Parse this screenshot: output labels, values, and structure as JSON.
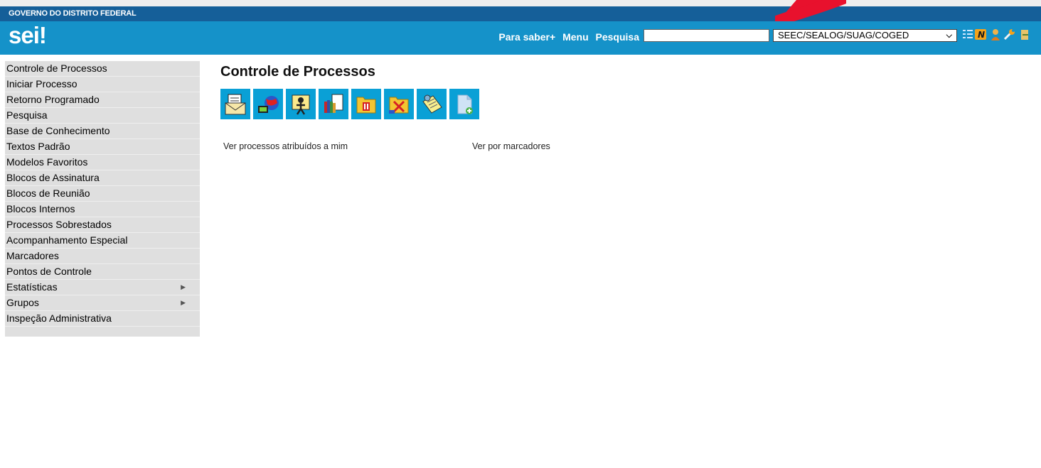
{
  "gov_title": "GOVERNO DO DISTRITO FEDERAL",
  "logo": {
    "text": "sei",
    "mark": "!"
  },
  "header": {
    "links": [
      "Para saber+",
      "Menu",
      "Pesquisa"
    ],
    "search": {
      "value": "",
      "placeholder": ""
    },
    "unit_select": "SEEC/SEALOG/SUAG/COGED",
    "icons": [
      "list-icon",
      "notepad-n-icon",
      "user-icon",
      "wrench-icon",
      "exit-icon"
    ]
  },
  "colors": {
    "gov_bar": "#155f99",
    "header": "#1592c9",
    "toolbar_button": "#0aa0d6",
    "sidebar": "#dfdfdf"
  },
  "sidebar": {
    "items": [
      {
        "label": "Controle de Processos"
      },
      {
        "label": "Iniciar Processo"
      },
      {
        "label": "Retorno Programado"
      },
      {
        "label": "Pesquisa"
      },
      {
        "label": "Base de Conhecimento"
      },
      {
        "label": "Textos Padrão"
      },
      {
        "label": "Modelos Favoritos"
      },
      {
        "label": "Blocos de Assinatura"
      },
      {
        "label": "Blocos de Reunião"
      },
      {
        "label": "Blocos Internos"
      },
      {
        "label": "Processos Sobrestados"
      },
      {
        "label": "Acompanhamento Especial"
      },
      {
        "label": "Marcadores"
      },
      {
        "label": "Pontos de Controle"
      },
      {
        "label": "Estatísticas",
        "submenu": true
      },
      {
        "label": "Grupos",
        "submenu": true
      },
      {
        "label": "Inspeção Administrativa"
      }
    ]
  },
  "main": {
    "title": "Controle de Processos",
    "toolbar_icons": [
      "envelope-icon",
      "globe-icon",
      "person-icon",
      "books-icon",
      "pause-icon",
      "folder-cancel-icon",
      "notes-icon",
      "new-document-icon"
    ],
    "links": [
      "Ver processos atribuídos a mim",
      "Ver por marcadores"
    ]
  }
}
